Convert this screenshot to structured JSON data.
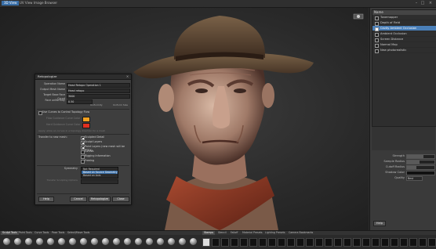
{
  "topbar": {
    "tabs": [
      "3D View",
      "UV View",
      "Image Browser"
    ],
    "active_tab": 0
  },
  "right_panel": {
    "list_header": "Name",
    "items": [
      {
        "label": "Tonemapper",
        "checked": false,
        "selected": false
      },
      {
        "label": "Depth of Field",
        "checked": false,
        "selected": false
      },
      {
        "label": "Cavity Ambient Occlusion",
        "checked": true,
        "selected": true
      },
      {
        "label": "Ambient Occlusion",
        "checked": false,
        "selected": false
      },
      {
        "label": "Screen Distance",
        "checked": false,
        "selected": false
      },
      {
        "label": "Normal Map",
        "checked": false,
        "selected": false
      },
      {
        "label": "New photorealistic",
        "checked": false,
        "selected": false
      }
    ],
    "sliders": [
      {
        "label": "Strength",
        "fraction": 0.6
      },
      {
        "label": "Sample Radius",
        "fraction": 0.45
      },
      {
        "label": "Cutoff Radius",
        "fraction": 0.35
      },
      {
        "label": "Shadow Color",
        "swatch": "#111111"
      },
      {
        "label": "Quality",
        "value": "Best"
      }
    ],
    "help_label": "Help"
  },
  "dialog": {
    "title": "Retopologize",
    "fields": [
      {
        "label": "Operation Name",
        "value": "Head Retopo Operation 1"
      },
      {
        "label": "Output Mesh Name",
        "value": "Head retopo"
      },
      {
        "label": "Target Base Face Count",
        "value": "3000"
      },
      {
        "label": "Face uniformity",
        "value": "0.50"
      }
    ],
    "uniform_labels": [
      "Uniformity",
      "Uniform Size"
    ],
    "use_curves_label": "Use Curves to Control Topology Flow",
    "color_rows": [
      {
        "label": "Flow Guidance Curve Color",
        "color": "#f0a020"
      },
      {
        "label": "Hard Guidance Curve Color",
        "color": "#e03020"
      }
    ],
    "note": "Apply: allow an curves in a topology direction for a mesh",
    "transfer_label": "Transfer to new mesh:",
    "transfer_options": [
      {
        "label": "Sculpted Detail",
        "checked": true
      },
      {
        "label": "Sculpt Layers",
        "checked": true
      },
      {
        "label": "Paint Layers (new mesh will be PTEX)",
        "checked": true
      },
      {
        "label": "Curves",
        "checked": false
      },
      {
        "label": "Rigging Information",
        "checked": false
      },
      {
        "label": "Freeing",
        "checked": false
      }
    ],
    "symmetry_label": "Symmetry",
    "symmetry_options": [
      "Not Required",
      "Based on Source Geometry",
      "Based on Axis"
    ],
    "symmetry_selected": 1,
    "transfer_settings_label": "Transfer Sculpting Options",
    "buttons": [
      "Help",
      "Cancel",
      "Retopologize",
      "Close"
    ]
  },
  "bottom_bar": {
    "tabs": [
      "Sculpt Tools",
      "Paint Tools",
      "Curve Tools",
      "Pose Tools",
      "Select/Move Tools"
    ],
    "active_tab": 0,
    "right_tabs": [
      "Stamps",
      "Stencil",
      "Falloff",
      "Material Presets",
      "Lighting Presets",
      "Camera Bookmarks"
    ],
    "right_active": 0
  },
  "colors": {
    "accent": "#3a6fa8",
    "selection": "#4a7fb8",
    "flow_curve": "#f0a020",
    "hard_curve": "#e03020"
  }
}
